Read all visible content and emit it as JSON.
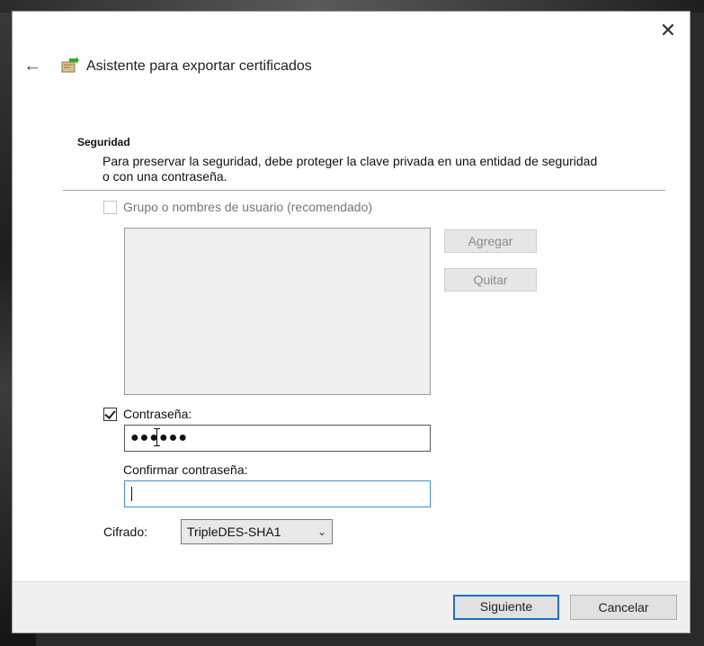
{
  "window": {
    "title": "Asistente para exportar certificados",
    "close_glyph": "✕",
    "back_glyph": "←"
  },
  "section": {
    "title": "Seguridad",
    "description": "Para preservar la seguridad, debe proteger la clave privada en una entidad de seguridad o con una contraseña."
  },
  "group_option": {
    "label": "Grupo o nombres de usuario (recomendado)",
    "checked": false,
    "enabled": false,
    "users": [],
    "add_label": "Agregar",
    "remove_label": "Quitar"
  },
  "password_option": {
    "label": "Contraseña:",
    "checked": true,
    "value": "●●●●●●"
  },
  "confirm": {
    "label": "Confirmar contraseña:",
    "value": ""
  },
  "encryption": {
    "label": "Cifrado:",
    "selected": "TripleDES-SHA1"
  },
  "footer": {
    "next_label": "Siguiente",
    "cancel_label": "Cancelar"
  },
  "icons": {
    "back": "back-arrow-icon",
    "wizard": "certificate-wizard-icon",
    "close": "close-icon",
    "dropdown": "chevron-down-icon"
  },
  "colors": {
    "accent": "#1a6fc9",
    "dialog_bg": "#ffffff",
    "footer_bg": "#f0f0f0"
  }
}
